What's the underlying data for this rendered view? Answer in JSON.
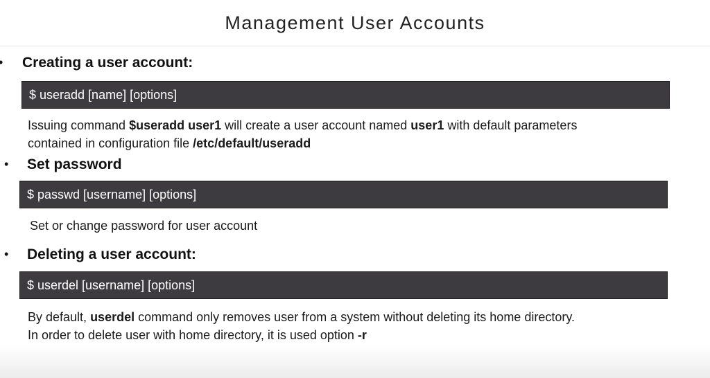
{
  "title": "Management User Accounts",
  "sections": [
    {
      "heading": "Creating a user account:",
      "command": "$ useradd [name]  [options]",
      "description": {
        "line1": {
          "t1": "Issuing command ",
          "b1": "$useradd user1",
          "t2": " will create a user account named ",
          "b2": "user1",
          "t3": " with default parameters"
        },
        "line2": {
          "t1": "contained in configuration file ",
          "b1": "/etc/default/useradd"
        }
      }
    },
    {
      "heading": "Set password",
      "command": "$ passwd [username] [options]",
      "description": {
        "line1": {
          "t1": "Set or change password for user account"
        }
      }
    },
    {
      "heading": "Deleting a user account:",
      "command": "$ userdel [username] [options]",
      "description": {
        "line1": {
          "t1": "By default, ",
          "b1": "userdel",
          "t2": " command only removes user from a system without deleting its home directory."
        },
        "line2": {
          "t1": "In order to delete user with home directory, it is used option ",
          "b1": "-r"
        }
      }
    }
  ]
}
